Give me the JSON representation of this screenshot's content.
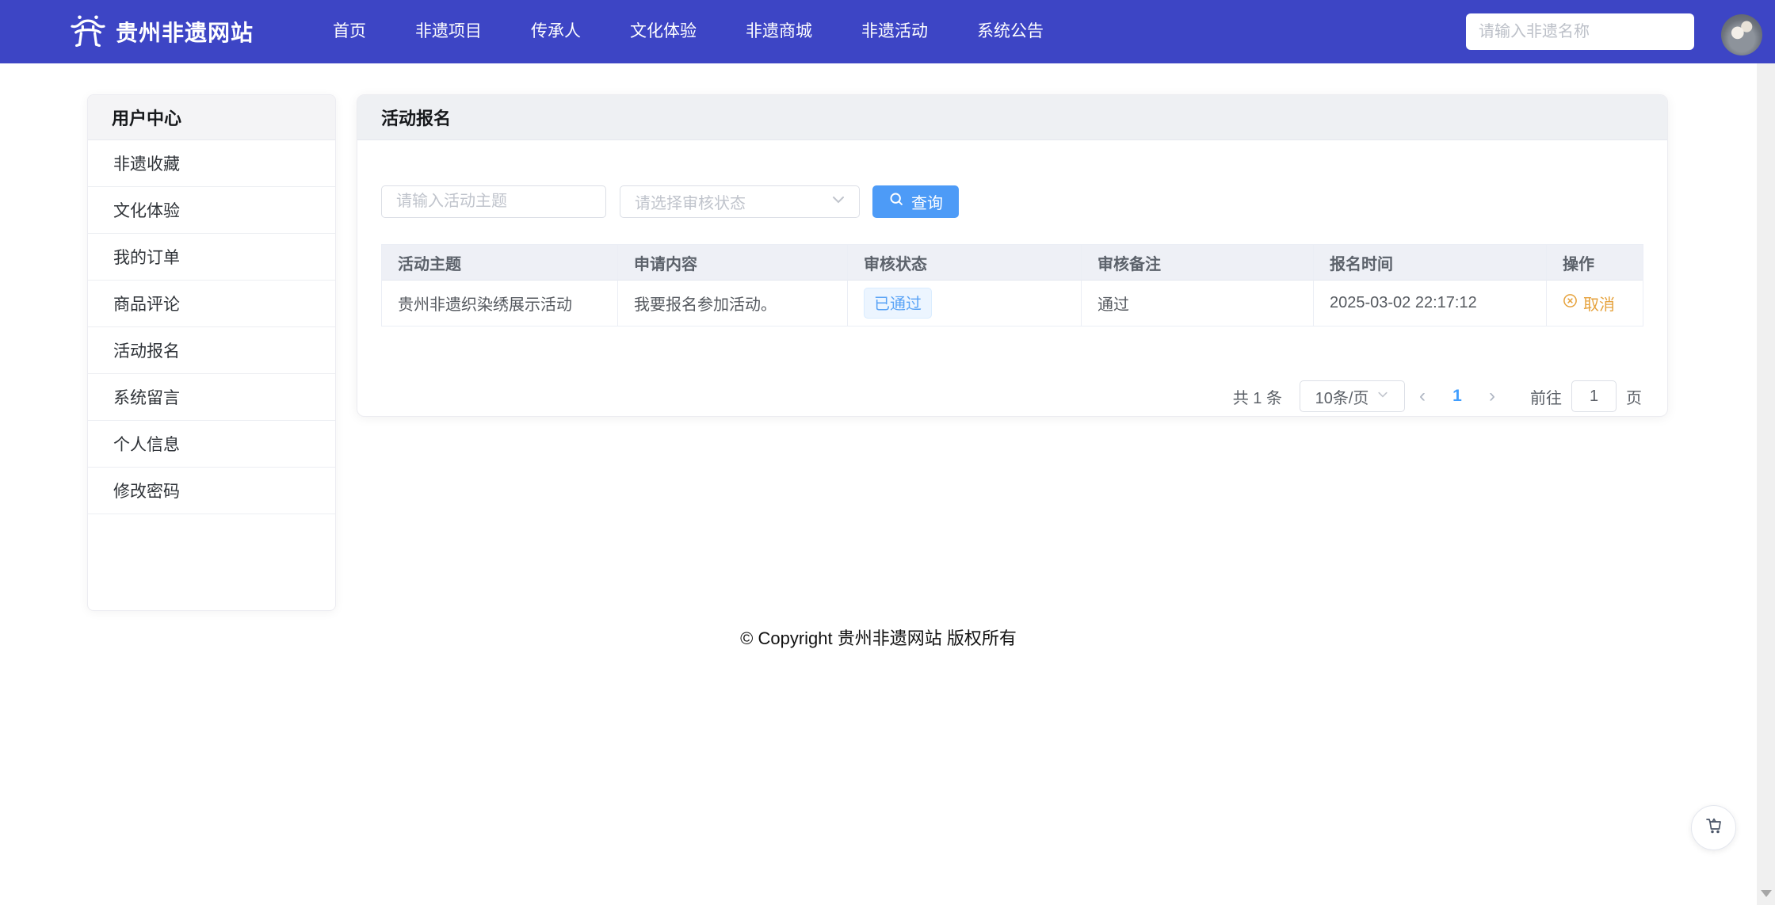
{
  "colors": {
    "navbar_bg": "#3d45c5",
    "accent_blue": "#409eff",
    "button_blue": "#4d9bf7",
    "warning_orange": "#e6a23c",
    "tag_bg": "#ecf5ff",
    "tag_border": "#d9ecff",
    "panel_header_bg": "#eef0f3",
    "table_header_bg": "#eef0f6",
    "scrollbar_track": "#f0f0f0"
  },
  "navbar": {
    "brand": "贵州非遗网站",
    "items": [
      {
        "label": "首页"
      },
      {
        "label": "非遗项目"
      },
      {
        "label": "传承人"
      },
      {
        "label": "文化体验"
      },
      {
        "label": "非遗商城"
      },
      {
        "label": "非遗活动"
      },
      {
        "label": "系统公告"
      }
    ],
    "search_placeholder": "请输入非遗名称"
  },
  "sidebar": {
    "title": "用户中心",
    "items": [
      {
        "label": "非遗收藏"
      },
      {
        "label": "文化体验"
      },
      {
        "label": "我的订单"
      },
      {
        "label": "商品评论"
      },
      {
        "label": "活动报名"
      },
      {
        "label": "系统留言"
      },
      {
        "label": "个人信息"
      },
      {
        "label": "修改密码"
      }
    ]
  },
  "panel": {
    "title": "活动报名",
    "filters": {
      "topic_placeholder": "请输入活动主题",
      "status_placeholder": "请选择审核状态",
      "search_button": "查询"
    },
    "table": {
      "columns": [
        "活动主题",
        "申请内容",
        "审核状态",
        "审核备注",
        "报名时间",
        "操作"
      ],
      "rows": [
        {
          "topic": "贵州非遗织染绣展示活动",
          "content": "我要报名参加活动。",
          "status": "已通过",
          "remark": "通过",
          "time": "2025-03-02 22:17:12",
          "action": "取消"
        }
      ]
    },
    "pagination": {
      "total_text": "共 1 条",
      "page_size": "10条/页",
      "prev": "‹",
      "current_page": "1",
      "next": "›",
      "goto_label": "前往",
      "goto_value": "1",
      "goto_unit": "页"
    }
  },
  "footer": {
    "copyright": "© Copyright 贵州非遗网站 版权所有"
  }
}
